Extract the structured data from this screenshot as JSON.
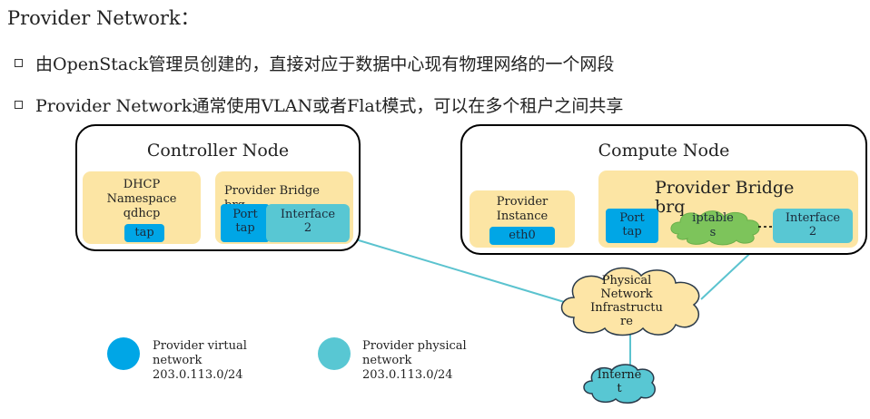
{
  "title": "Provider Network：",
  "bullets": [
    "由OpenStack管理员创建的，直接对应于数据中心现有物理网络的一个网段",
    "Provider Network通常使用VLAN或者Flat模式，可以在多个租户之间共享"
  ],
  "controller": {
    "title": "Controller Node",
    "dhcp_label": "DHCP\nNamespace\nqdhcp",
    "dhcp_tap": "tap",
    "bridge_label": "Provider Bridge\nbrq",
    "port_tap": "Port\ntap",
    "interface": "Interface\n2"
  },
  "compute": {
    "title": "Compute Node",
    "instance_label": "Provider\nInstance",
    "instance_eth": "eth0",
    "bridge_label": "Provider Bridge\nbrq",
    "port_tap": "Port\ntap",
    "iptables": "iptable\ns",
    "interface": "Interface\n2"
  },
  "physical_network": "Physical\nNetwork\nInfrastructu\nre",
  "internet": "Interne\nt",
  "legend": [
    {
      "label": "Provider virtual\nnetwork\n203.0.113.0/24",
      "color": "#00a6e6"
    },
    {
      "label": "Provider physical\nnetwork\n203.0.113.0/24",
      "color": "#58c7d3"
    }
  ],
  "colors": {
    "yellow_box": "#fce5a4",
    "blue": "#00a6e6",
    "teal": "#58c7d3",
    "line": "#5bc3cf",
    "cloud": "#fde5a6",
    "green_cloud": "#7dc45b"
  }
}
